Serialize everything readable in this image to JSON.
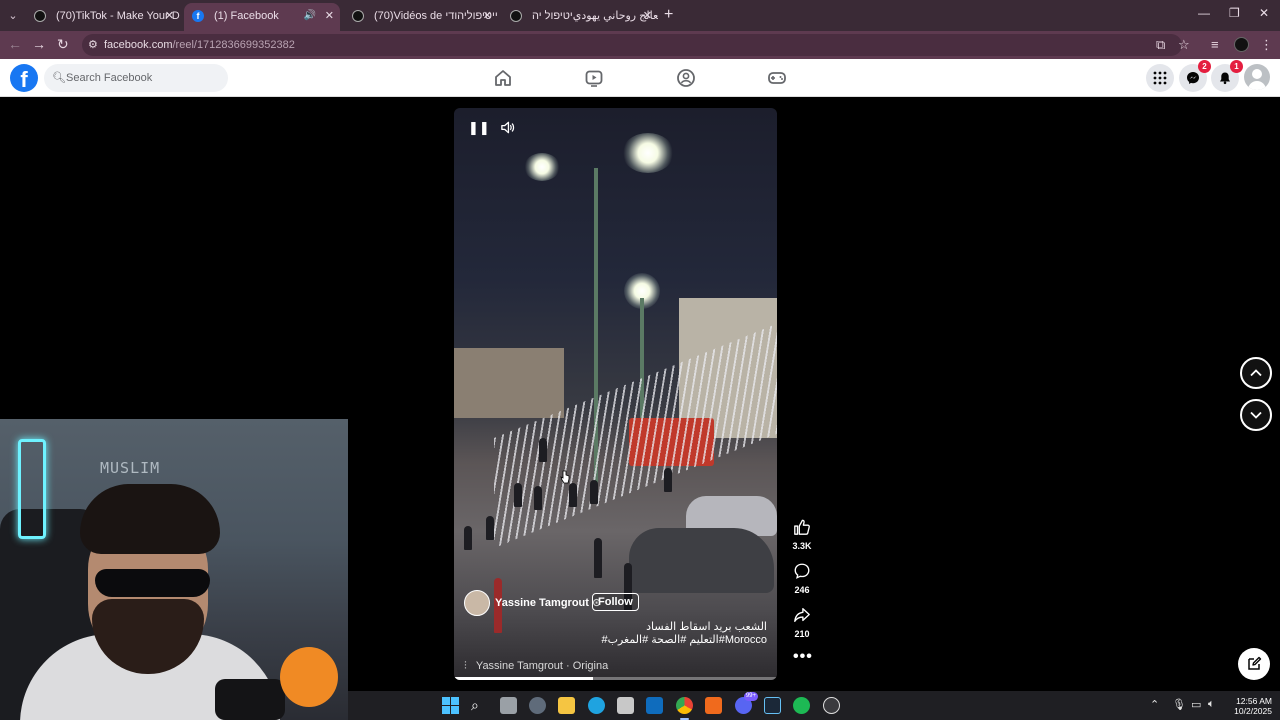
{
  "browser": {
    "tabs": [
      {
        "title": "(70)TikTok - Make Your Day",
        "favicon": "tiktok-icon",
        "active": false
      },
      {
        "title": "(1) Facebook",
        "favicon": "facebook-icon",
        "active": true,
        "audio": true
      },
      {
        "title": "(70)Vidéos de ‏יהודי‏יטיפול‏יהודי",
        "favicon": "tiktok-icon",
        "active": false
      },
      {
        "title": "‏‏‏(70)معالج روحاني يهودي‏יטיפול ‏יה‏",
        "favicon": "tiktok-icon",
        "active": false
      }
    ],
    "url_host": "facebook.com",
    "url_path": "/reel/1712836699352382"
  },
  "facebook": {
    "search_placeholder": "Search Facebook",
    "nav": [
      "home-icon",
      "video-icon",
      "groups-icon",
      "gaming-icon"
    ],
    "messenger_badge": "2",
    "notifications_badge": "1",
    "brand_color": "#1877f2"
  },
  "reel": {
    "owner_name": "Yassine Tamgrout",
    "verified_mark": "⊙",
    "follow_label": "Follow",
    "caption_line1": "الشعب بريد اسقاط الفساد",
    "caption_line2": "Morocco#التعليم #الصحة #المغرب#",
    "audio_label": "Yassine Tamgrout · Origina",
    "progress": 0.43,
    "likes": "3.3K",
    "comments": "246",
    "shares": "210"
  },
  "webcam": {
    "sign_text": "MUSLIM"
  },
  "taskbar": {
    "discord_badge": "99+",
    "time": "12:56 AM",
    "date": "10/2/2025"
  }
}
